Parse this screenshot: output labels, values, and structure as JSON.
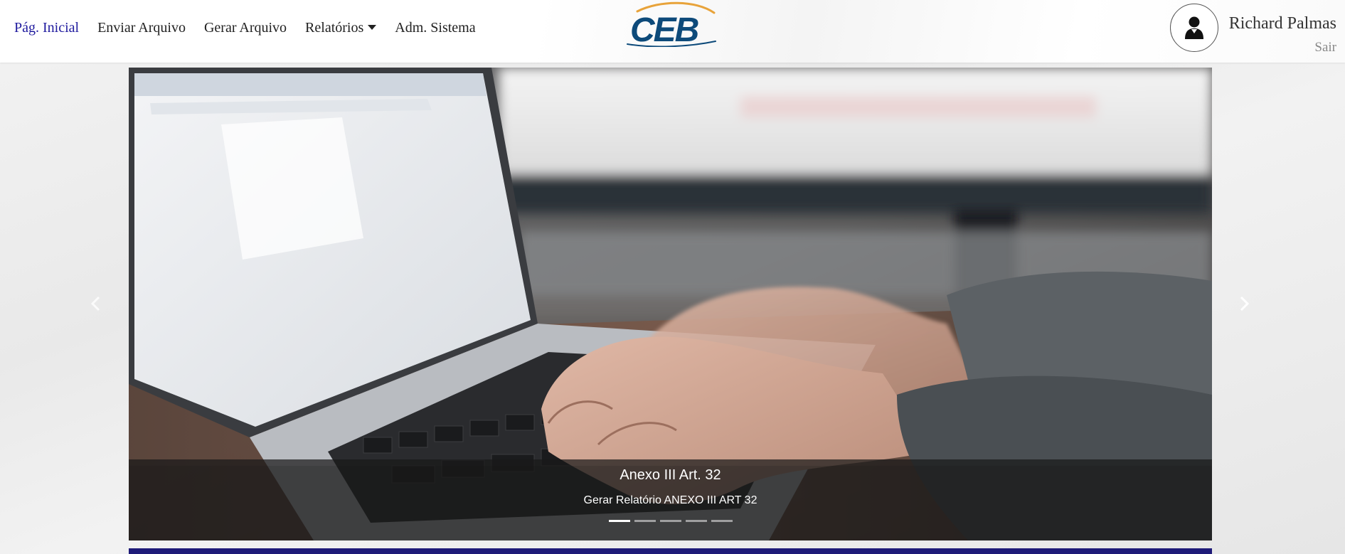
{
  "nav": {
    "items": [
      {
        "label": "Pág. Inicial",
        "active": true
      },
      {
        "label": "Enviar Arquivo",
        "active": false
      },
      {
        "label": "Gerar Arquivo",
        "active": false
      },
      {
        "label": "Relatórios",
        "active": false,
        "dropdown": true
      },
      {
        "label": "Adm. Sistema",
        "active": false
      }
    ],
    "active_color": "#1f1a9e",
    "text_color": "#212121"
  },
  "logo": {
    "text": "CEB",
    "color": "#0d4a7a",
    "swoosh_color": "#e8a33a"
  },
  "user": {
    "name": "Richard Palmas",
    "logout_label": "Sair",
    "avatar_icon": "user-silhouette-icon"
  },
  "carousel": {
    "slide": {
      "title": "Anexo III Art. 32",
      "subtitle": "Gerar Relatório ANEXO III ART 32",
      "image": "laptop-typing-photo"
    },
    "indicator_count": 5,
    "active_index": 0,
    "prev_icon": "chevron-left-icon",
    "next_icon": "chevron-right-icon"
  },
  "colors": {
    "bottom_bar": "#1e1a78"
  }
}
